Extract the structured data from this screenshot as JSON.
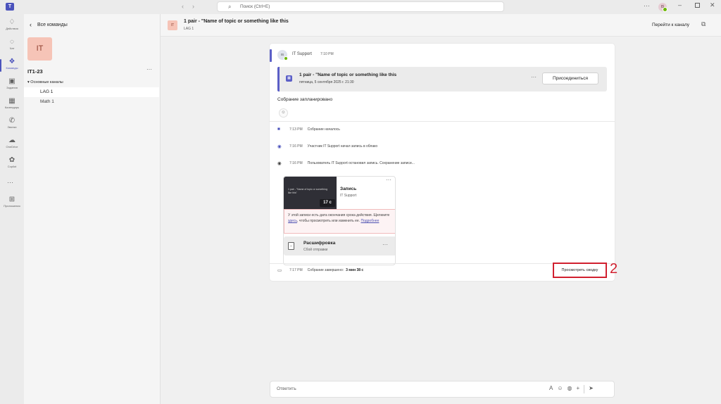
{
  "titlebar": {
    "search_placeholder": "Поиск (Ctrl+E)",
    "avatar_initials": "IS"
  },
  "rail": {
    "items": [
      {
        "icon": "bell-icon",
        "label": "Действия"
      },
      {
        "icon": "chat-icon",
        "label": "Чат"
      },
      {
        "icon": "teams-icon",
        "label": "Команды"
      },
      {
        "icon": "tasks-icon",
        "label": "Задания"
      },
      {
        "icon": "calendar-icon",
        "label": "Календарь"
      },
      {
        "icon": "calls-icon",
        "label": "Звонки"
      },
      {
        "icon": "onedrive-icon",
        "label": "OneDrive"
      },
      {
        "icon": "copilot-icon",
        "label": "Copilot"
      },
      {
        "icon": "apps-icon",
        "label": "Приложения"
      }
    ]
  },
  "panel": {
    "back_label": "Все команды",
    "team_tile": "IT",
    "team_name": "IT1-23",
    "group_label": "Основные каналы",
    "channels": [
      "LAG 1",
      "Math 1"
    ]
  },
  "header": {
    "tile": "IT",
    "title": "1 pair - \"Name of topic or something like this",
    "subtitle": "LAG 1",
    "goto_label": "Перейти к каналу"
  },
  "post": {
    "avatar": "IS",
    "sender": "IT Support",
    "time": "7:10 PM",
    "meeting_title": "1 pair - \"Name of topic or something like this",
    "meeting_date": "пятница, 5 сентября 2025 г. 21:30",
    "join_label": "Присоединиться",
    "scheduled": "Собрание запланировано",
    "events": [
      {
        "time": "7:13 PM",
        "text": "Собрание началось"
      },
      {
        "time": "7:16 PM",
        "text": "Участник IT Support начал запись в облако"
      },
      {
        "time": "7:16 PM",
        "text": "Пользователь IT Support остановил запись. Сохранение записи..."
      }
    ],
    "recording": {
      "thumb_text": "1 pair - \"Name of topic or something like this\"",
      "duration": "17 с",
      "title": "Запись",
      "owner": "IT Support",
      "warn_text_1": "У этой записи есть дата окончания срока действия. Щелкните",
      "warn_link": "здесь",
      "warn_text_2": ", чтобы просмотреть или изменить ее.",
      "warn_more": "Подробнее"
    },
    "transcript": {
      "title": "Расшифровка",
      "subtitle": "Сбой отправки"
    },
    "end_time": "7:17 PM",
    "end_text": "Собрание завершено:",
    "end_duration": "3 мин 38 с",
    "summary_label": "Просмотреть сводку"
  },
  "annotation": "2",
  "compose": {
    "placeholder": "Ответить"
  }
}
